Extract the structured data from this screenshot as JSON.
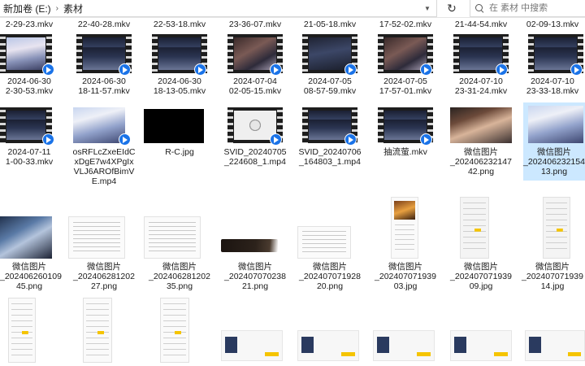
{
  "address": {
    "crumbs": [
      "新加卷 (E:)",
      "素材"
    ],
    "separator": "›"
  },
  "search": {
    "placeholder": "在 素材 中搜索"
  },
  "icons": {
    "search": "search-icon",
    "refresh": "refresh-icon",
    "dropdown": "chevron-down-icon",
    "video_badge": "play-badge-icon"
  },
  "colors": {
    "selection": "#cce8ff",
    "play_badge": "#1a73e8"
  },
  "files": {
    "row0": [
      "2-29-23.mkv",
      "22-40-28.mkv",
      "22-53-18.mkv",
      "23-36-07.mkv",
      "21-05-18.mkv",
      "17-52-02.mkv",
      "21-44-54.mkv",
      "02-09-13.mkv"
    ],
    "row1": [
      [
        "2024-06-30",
        "2-30-53.mkv"
      ],
      [
        "2024-06-30",
        "18-11-57.mkv"
      ],
      [
        "2024-06-30",
        "18-13-05.mkv"
      ],
      [
        "2024-07-04",
        "02-05-15.mkv"
      ],
      [
        "2024-07-05",
        "08-57-59.mkv"
      ],
      [
        "2024-07-05",
        "17-57-01.mkv"
      ],
      [
        "2024-07-10",
        "23-31-24.mkv"
      ],
      [
        "2024-07-10",
        "23-33-18.mkv"
      ]
    ],
    "row2": [
      [
        "2024-07-11",
        "1-00-33.mkv"
      ],
      [
        "osRFLcZxeEIdC",
        "xDgE7w4XPgIx",
        "VLJ6AROfBimV",
        "E.mp4"
      ],
      [
        "R-C.jpg"
      ],
      [
        "SVID_20240705",
        "_224608_1.mp4"
      ],
      [
        "SVID_20240706",
        "_164803_1.mp4"
      ],
      [
        "抽流萤.mkv"
      ],
      [
        "微信图片",
        "_202406232147",
        "42.png"
      ],
      [
        "微信图片",
        "_202406232154",
        "13.png"
      ]
    ],
    "row3": [
      [
        "微信图片",
        "_202406260109",
        "45.png"
      ],
      [
        "微信图片",
        "_202406281202",
        "27.png"
      ],
      [
        "微信图片",
        "_202406281202",
        "35.png"
      ],
      [
        "微信图片",
        "_202407070238",
        "21.png"
      ],
      [
        "微信图片",
        "_202407071928",
        "20.png"
      ],
      [
        "微信图片",
        "_202407071939",
        "03.jpg"
      ],
      [
        "微信图片",
        "_202407071939",
        "09.jpg"
      ],
      [
        "微信图片",
        "_202407071939",
        "14.jpg"
      ]
    ]
  }
}
